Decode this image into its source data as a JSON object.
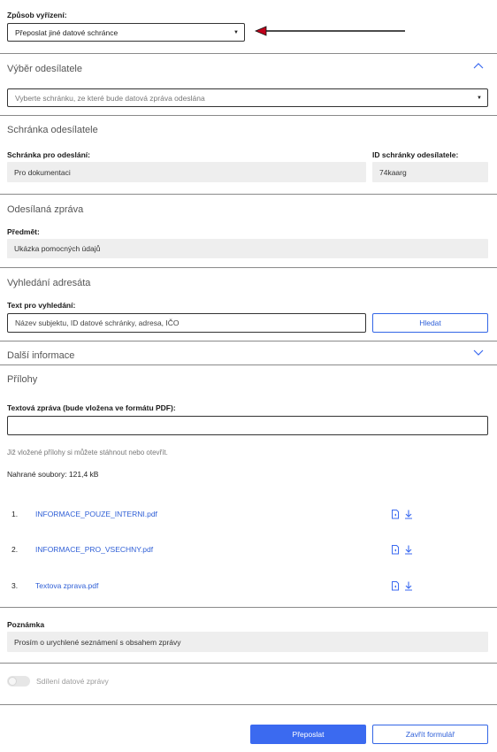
{
  "zpusob": {
    "label": "Způsob vyřízení:",
    "value": "Přeposlat jiné datové schránce"
  },
  "vyber": {
    "title": "Výběr odesílatele",
    "placeholder": "Vyberte schránku, ze které bude datová zpráva odeslána"
  },
  "schranka": {
    "title": "Schránka odesílatele",
    "pro_odeslani_label": "Schránka pro odeslání:",
    "pro_odeslani_value": "Pro dokumentaci",
    "id_label": "ID schránky odesílatele:",
    "id_value": "74kaarg"
  },
  "zprava": {
    "title": "Odesílaná zpráva",
    "predmet_label": "Předmět:",
    "predmet_value": "Ukázka pomocných údajů"
  },
  "vyhledani": {
    "title": "Vyhledání adresáta",
    "text_label": "Text pro vyhledání:",
    "placeholder": "Název subjektu, ID datové schránky, adresa, IČO",
    "search_button": "Hledat"
  },
  "dalsi": {
    "title": "Další informace"
  },
  "prilohy": {
    "title": "Přílohy",
    "textova_label": "Textová zpráva (bude vložena ve formátu PDF):",
    "hint": "Již vložené přílohy si můžete stáhnout nebo otevřít.",
    "uploaded": "Nahrané soubory: 121,4 kB",
    "files": [
      {
        "num": "1.",
        "name": "INFORMACE_POUZE_INTERNI.pdf"
      },
      {
        "num": "2.",
        "name": "INFORMACE_PRO_VSECHNY.pdf"
      },
      {
        "num": "3.",
        "name": "Textova zprava.pdf"
      }
    ]
  },
  "poznamka": {
    "label": "Poznámka",
    "value": "Prosím o urychlené seznámení s obsahem zprávy"
  },
  "sdileni": {
    "label": "Sdílení datové zprávy"
  },
  "actions": {
    "primary": "Přeposlat",
    "secondary": "Zavřít formulář"
  },
  "colors": {
    "accent": "#3b6af0",
    "link": "#2f5fd6",
    "arrow": "#c0001a",
    "readonly_bg": "#eeeeee"
  }
}
